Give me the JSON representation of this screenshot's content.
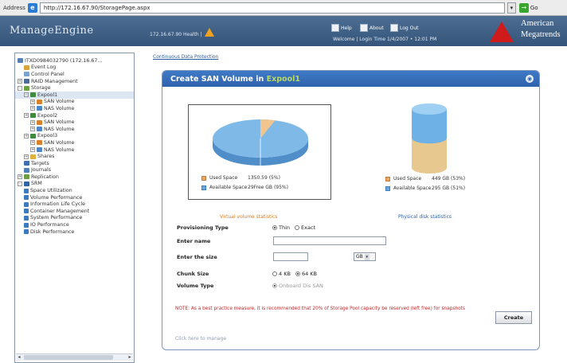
{
  "browser": {
    "address_label": "Address",
    "url": "http://172.16.67.90/StoragePage.aspx",
    "go_label": "Go"
  },
  "header": {
    "app_title": "ManageEngine",
    "host": "172.16.67.90 Health |",
    "toolbar": [
      {
        "label": "Help"
      },
      {
        "label": "About"
      },
      {
        "label": "Log Out"
      }
    ],
    "login_info": "Welcome | Login Time 1/4/2007 • 12:01 PM",
    "brand_line1": "American",
    "brand_line2": "Megatrends"
  },
  "tree": {
    "items": [
      {
        "label": "ITXD0984032790 (172.16.67...",
        "icon": "server-icon",
        "level": 0,
        "expander": ""
      },
      {
        "label": "Event Log",
        "icon": "event-log-icon",
        "level": 1,
        "expander": ""
      },
      {
        "label": "Control Panel",
        "icon": "control-panel-icon",
        "level": 1,
        "expander": ""
      },
      {
        "label": "RAID Management",
        "icon": "raid-icon",
        "level": 0,
        "expander": "+"
      },
      {
        "label": "Storage",
        "icon": "storage-icon",
        "level": 0,
        "expander": "-"
      },
      {
        "label": "Expool1",
        "icon": "pool-icon",
        "level": 1,
        "expander": "-",
        "selected": true
      },
      {
        "label": "SAN Volume",
        "icon": "san-volume-icon",
        "level": 2,
        "expander": "+"
      },
      {
        "label": "NAS Volume",
        "icon": "nas-volume-icon",
        "level": 2,
        "expander": "+"
      },
      {
        "label": "Expool2",
        "icon": "pool-icon",
        "level": 1,
        "expander": "+"
      },
      {
        "label": "SAN Volume",
        "icon": "san-volume-icon",
        "level": 2,
        "expander": "+"
      },
      {
        "label": "NAS Volume",
        "icon": "nas-volume-icon",
        "level": 2,
        "expander": "+"
      },
      {
        "label": "Expool3",
        "icon": "pool-icon",
        "level": 1,
        "expander": "+"
      },
      {
        "label": "SAN Volume",
        "icon": "san-volume-icon",
        "level": 2,
        "expander": "+"
      },
      {
        "label": "NAS Volume",
        "icon": "nas-volume-icon",
        "level": 2,
        "expander": "+"
      },
      {
        "label": "Shares",
        "icon": "shares-icon",
        "level": 1,
        "expander": "+"
      },
      {
        "label": "Targets",
        "icon": "targets-icon",
        "level": 1,
        "expander": ""
      },
      {
        "label": "Journals",
        "icon": "journals-icon",
        "level": 1,
        "expander": ""
      },
      {
        "label": "Replication",
        "icon": "replication-icon",
        "level": 0,
        "expander": "+"
      },
      {
        "label": "SRM",
        "icon": "srm-icon",
        "level": 0,
        "expander": "-"
      },
      {
        "label": "Space Utilization",
        "icon": "report-icon",
        "level": 1,
        "expander": ""
      },
      {
        "label": "Volume Performance",
        "icon": "report-icon",
        "level": 1,
        "expander": ""
      },
      {
        "label": "Information Life Cycle",
        "icon": "report-icon",
        "level": 1,
        "expander": ""
      },
      {
        "label": "Container Management",
        "icon": "report-icon",
        "level": 1,
        "expander": ""
      },
      {
        "label": "System Performance",
        "icon": "report-icon",
        "level": 1,
        "expander": ""
      },
      {
        "label": "IO Performance",
        "icon": "report-icon",
        "level": 1,
        "expander": ""
      },
      {
        "label": "Disk Performance",
        "icon": "report-icon",
        "level": 1,
        "expander": ""
      }
    ]
  },
  "breadcrumb": "Continuous Data Protection",
  "dialog": {
    "title_prefix": "Create SAN Volume in",
    "pool_name": "Expool1",
    "close_glyph": "◉",
    "virtual_legend": {
      "used_label": "Used Space",
      "used_value": "1350.59 (5%)",
      "avail_label": "Available Space",
      "avail_value": "29Free GB (95%)"
    },
    "physical_legend": {
      "used_label": "Used Space",
      "used_value": "449 GB (53%)",
      "avail_label": "Available Space",
      "avail_value": "295 GB (51%)"
    },
    "virtual_stats_link": "Virtual volume statistics",
    "physical_stats_link": "Physical disk statistics",
    "form": {
      "provisioning_label": "Provisioning Type",
      "provisioning_options": [
        "Thin",
        "Exact"
      ],
      "provisioning_selected": "Thin",
      "name_label": "Enter name",
      "name_value": "",
      "size_label": "Enter the size",
      "size_value": "",
      "size_unit": "GB",
      "chunk_label": "Chunk Size",
      "chunk_options": [
        "4 KB",
        "64 KB"
      ],
      "chunk_selected": "64 KB",
      "volume_type_label": "Volume Type",
      "volume_type_option": "Onboard Dis SAN"
    },
    "note": "NOTE: As a best practice measure, it is recommended that 20% of Storage Pool capacity be reserved (left free) for snapshots",
    "create_button": "Create",
    "footer_link": "Click here to manage"
  },
  "colors": {
    "header_bg": "#3e5f87",
    "dialog_title_bg": "#3a71bb",
    "pool_name_color": "#b9d963",
    "used_color": "#e6a869",
    "available_color": "#6aa6dc",
    "note_color": "#c62828",
    "brand_red": "#d11a1a"
  },
  "chart_data": [
    {
      "type": "pie",
      "title": "Virtual volume statistics",
      "series": [
        {
          "name": "Used Space",
          "values": [
            5
          ]
        },
        {
          "name": "Available Space",
          "values": [
            95
          ]
        }
      ]
    },
    {
      "type": "bar",
      "title": "Physical disk statistics",
      "series": [
        {
          "name": "Used Space",
          "values": [
            53
          ]
        },
        {
          "name": "Available Space",
          "values": [
            51
          ]
        }
      ]
    }
  ]
}
